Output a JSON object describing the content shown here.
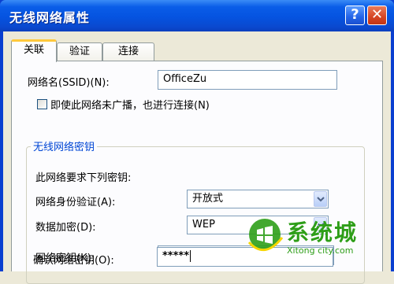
{
  "window": {
    "title": "无线网络属性",
    "help_label": "?",
    "close_label": "✕"
  },
  "tabs": [
    {
      "label": "关联",
      "active": true
    },
    {
      "label": "验证",
      "active": false
    },
    {
      "label": "连接",
      "active": false
    }
  ],
  "ssid": {
    "label": "网络名(SSID)(N):",
    "value": "OfficeZu"
  },
  "broadcast_checkbox": {
    "label": "即使此网络未广播，也进行连接(N)",
    "checked": false
  },
  "key_group": {
    "title": "无线网络密钥",
    "description": "此网络要求下列密钥:",
    "auth": {
      "label": "网络身份验证(A):",
      "value": "开放式"
    },
    "encryption": {
      "label": "数据加密(D):",
      "value": "WEP"
    },
    "network_key": {
      "label": "网络密钥(K):",
      "value": "*****"
    },
    "confirm_key": {
      "label": "确认网络密钥(O):",
      "value": "*****"
    }
  },
  "watermark": {
    "brand": "系统城",
    "site": "Xitong city.com"
  },
  "colors": {
    "titlebar": "#0553e0",
    "dialog_bg": "#ece9d8",
    "group_title": "#0046d5",
    "watermark_green": "#2e9e18"
  }
}
